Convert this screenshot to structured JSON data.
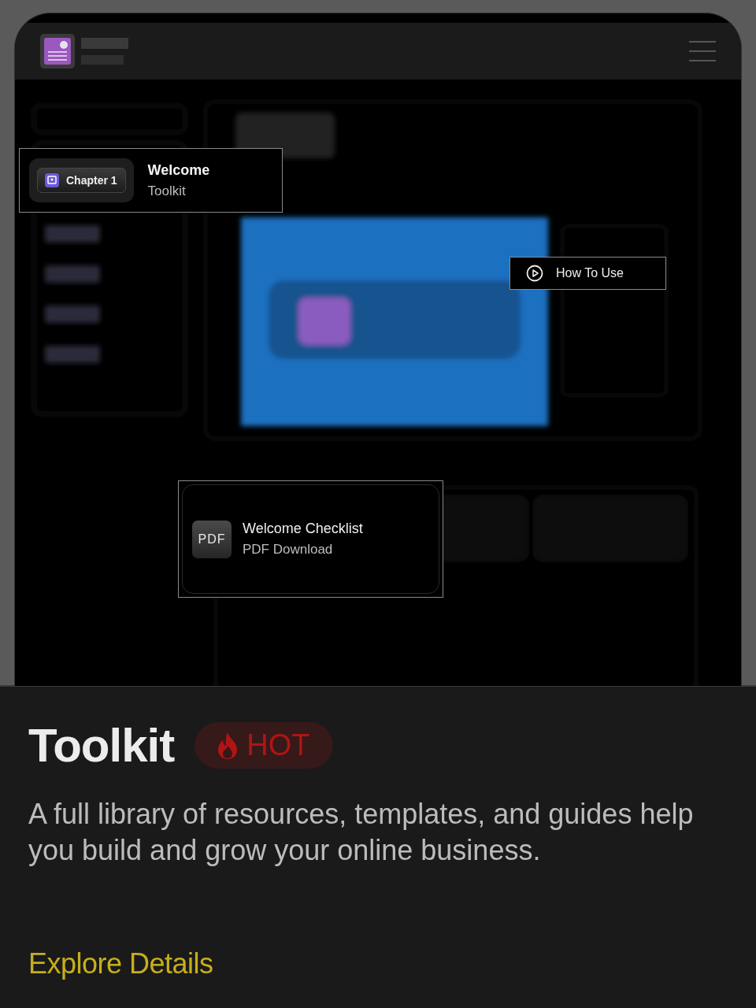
{
  "preview": {
    "kind": "picture",
    "callouts": [
      {
        "kind": "chapter",
        "badge": "Chapter 1",
        "title": "Welcome",
        "subtitle": "Toolkit"
      },
      {
        "kind": "link",
        "label": "How To Use"
      },
      {
        "kind": "file",
        "icon_text": "PDF",
        "title": "Welcome Checklist",
        "subtitle": "PDF Download"
      }
    ]
  },
  "product": {
    "title": "Toolkit",
    "badge": "HOT",
    "description": "A full library of resources, templates, and guides help you build and grow your online business.",
    "link": "Explore Details"
  }
}
